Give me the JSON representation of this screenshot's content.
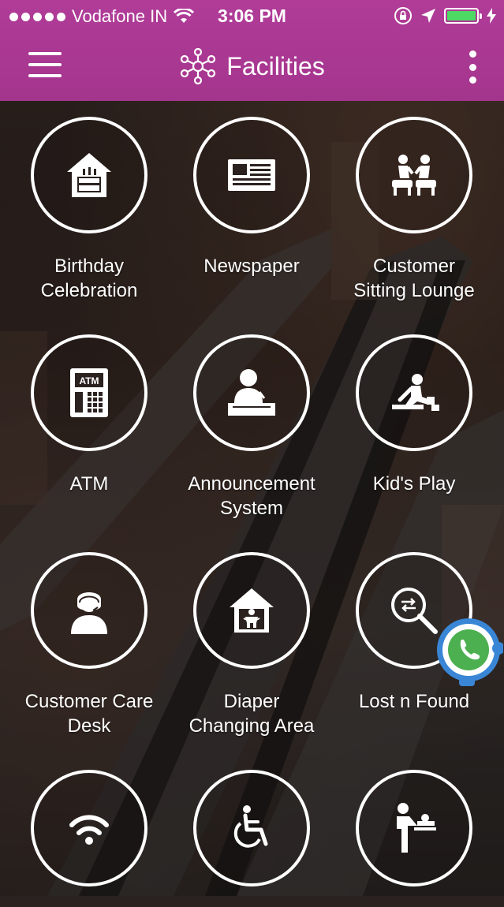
{
  "status_bar": {
    "carrier": "Vodafone IN",
    "time": "3:06 PM"
  },
  "header": {
    "title": "Facilities",
    "accent_color": "#a4358d"
  },
  "facilities": [
    {
      "label_line1": "Birthday",
      "label_line2": "Celebration",
      "icon": "birthday-cake-house-icon"
    },
    {
      "label_line1": "Newspaper",
      "label_line2": "",
      "icon": "newspaper-icon"
    },
    {
      "label_line1": "Customer",
      "label_line2": "Sitting Lounge",
      "icon": "lounge-seating-icon"
    },
    {
      "label_line1": "ATM",
      "label_line2": "",
      "icon": "atm-icon"
    },
    {
      "label_line1": "Announcement",
      "label_line2": "System",
      "icon": "announcement-podium-icon"
    },
    {
      "label_line1": "Kid's Play",
      "label_line2": "",
      "icon": "kids-play-icon"
    },
    {
      "label_line1": "Customer Care",
      "label_line2": "Desk",
      "icon": "customer-care-agent-icon"
    },
    {
      "label_line1": "Diaper",
      "label_line2": "Changing Area",
      "icon": "diaper-changing-house-icon"
    },
    {
      "label_line1": "Lost n Found",
      "label_line2": "",
      "icon": "lost-found-magnifier-icon"
    },
    {
      "label_line1": "",
      "label_line2": "",
      "icon": "wifi-icon"
    },
    {
      "label_line1": "",
      "label_line2": "",
      "icon": "wheelchair-icon"
    },
    {
      "label_line1": "",
      "label_line2": "",
      "icon": "baby-change-station-icon"
    }
  ],
  "chat_fab": {
    "icon": "whatsapp-chat-icon"
  }
}
